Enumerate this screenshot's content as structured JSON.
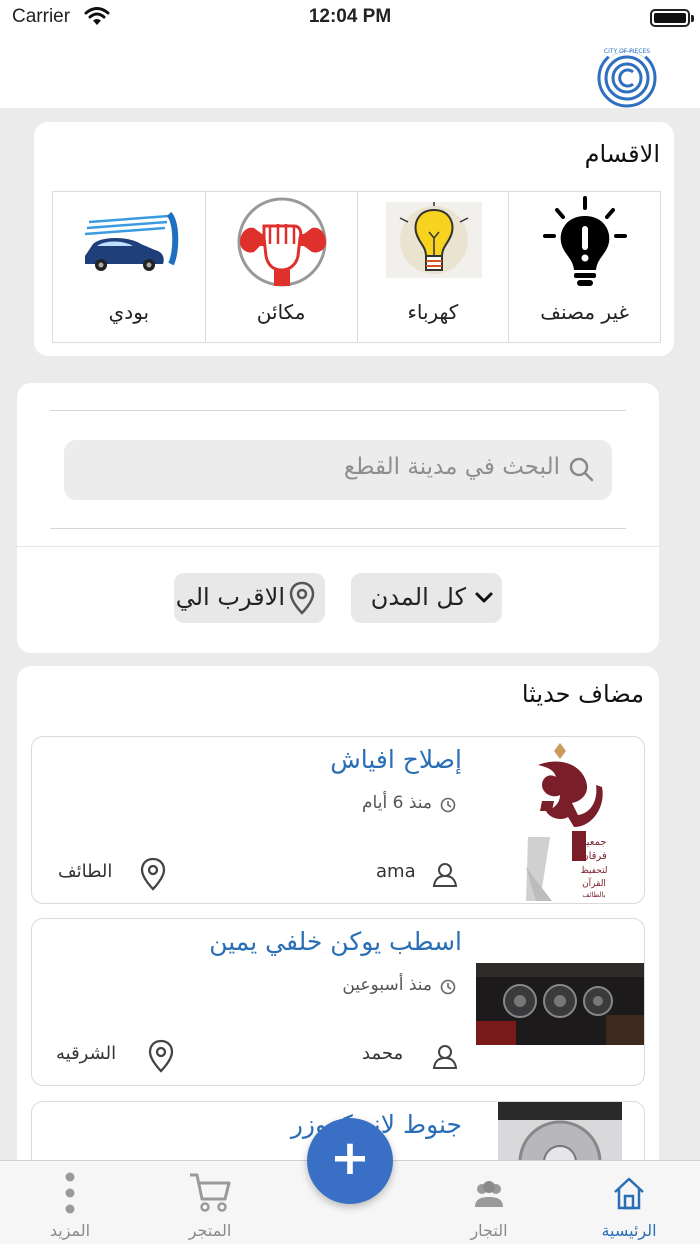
{
  "status": {
    "carrier": "Carrier",
    "time": "12:04 PM"
  },
  "categories": {
    "title": "الاقسام",
    "items": [
      {
        "label": "غير مصنف",
        "icon": "lightbulb-icon"
      },
      {
        "label": "كهرباء",
        "icon": "sketch-bulb-icon"
      },
      {
        "label": "مكائن",
        "icon": "wrench-fist-icon"
      },
      {
        "label": "بودي",
        "icon": "car-wash-icon"
      }
    ]
  },
  "search": {
    "placeholder": "البحث في مدينة القطع"
  },
  "filters": {
    "city": "كل المدن",
    "nearest": "الاقرب الي"
  },
  "recent": {
    "title": "مضاف حديثا",
    "items": [
      {
        "title": "إصلاح افياش",
        "time": "منذ 6 أيام",
        "user": "ama",
        "city": "الطائف"
      },
      {
        "title": "اسطب يوكن خلفي يمين",
        "time": "منذ أسبوعين",
        "user": "محمد",
        "city": "الشرقيه"
      },
      {
        "title": "جنوط لاند كروزر"
      }
    ]
  },
  "tabs": {
    "home": "الرئيسية",
    "merchants": "التجار",
    "store": "المتجر",
    "more": "المزيد"
  },
  "fab": "+",
  "colors": {
    "accent": "#2a6fb5",
    "fab": "#3a6fc6"
  }
}
